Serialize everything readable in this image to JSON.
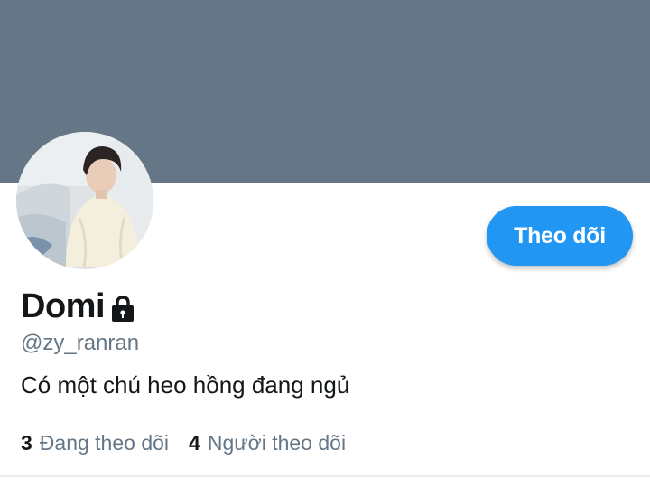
{
  "profile": {
    "banner_color": "#657786",
    "display_name": "Domi",
    "protected_icon": "lock-icon",
    "handle": "@zy_ranran",
    "bio": "Có một chú heo hồng đang ngủ",
    "follow_button_label": "Theo dõi",
    "accent_color": "#2196f3"
  },
  "stats": {
    "following_count": "3",
    "following_label": "Đang theo dõi",
    "followers_count": "4",
    "followers_label": "Người theo dõi"
  }
}
